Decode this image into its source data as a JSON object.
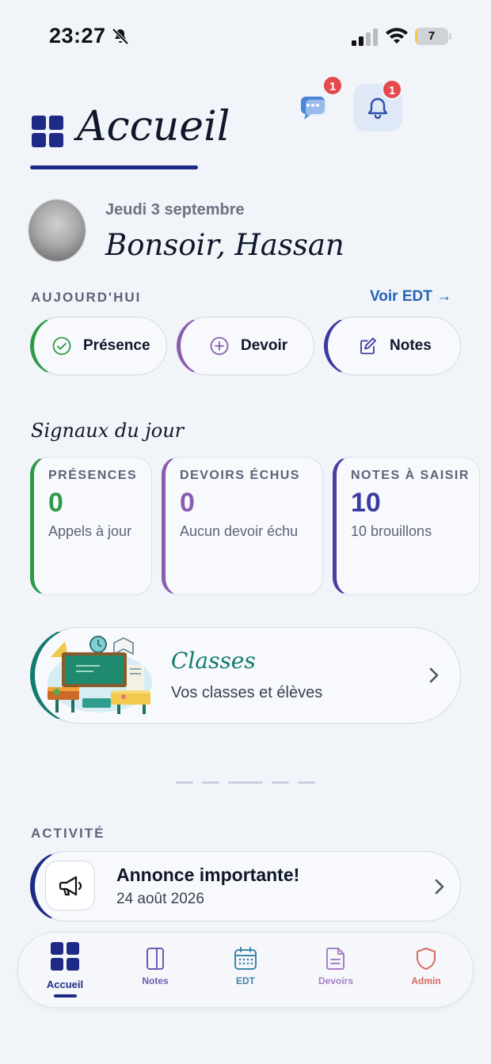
{
  "status_bar": {
    "time": "23:27",
    "battery_level": "7",
    "battery_fill": 0.07
  },
  "header": {
    "title": "Accueil",
    "chat_badge": "1",
    "notification_badge": "1"
  },
  "greeting": {
    "date": "Jeudi 3 septembre",
    "text": "Bonsoir, Hassan"
  },
  "today": {
    "label": "AUJOURD'HUI",
    "timetable_link": "Voir EDT →",
    "actions": [
      {
        "label": "Présence",
        "icon": "check-circle-icon",
        "color": "#2e9a47"
      },
      {
        "label": "Devoir",
        "icon": "plus-circle-icon",
        "color": "#8a5cb0"
      },
      {
        "label": "Notes",
        "icon": "edit-icon",
        "color": "#3b3aa0"
      }
    ]
  },
  "signals": {
    "title": "Signaux du jour",
    "cards": [
      {
        "label": "PRÉSENCES",
        "value": "0",
        "sub": "Appels à jour",
        "color": "#2e9a47"
      },
      {
        "label": "DEVOIRS ÉCHUS",
        "value": "0",
        "sub": "Aucun devoir échu",
        "color": "#8a5cb0"
      },
      {
        "label": "NOTES À SAISIR",
        "value": "10",
        "sub": "10 brouillons",
        "color": "#3b3aa0"
      }
    ]
  },
  "classes": {
    "title": "Classes",
    "subtitle": "Vos classes et élèves",
    "icon": "classroom-illustration"
  },
  "activity": {
    "label": "ACTIVITÉ",
    "item": {
      "title": "Annonce importante!",
      "date": "24 août 2026",
      "icon": "megaphone-icon"
    }
  },
  "bottom_nav": {
    "items": [
      {
        "label": "Accueil",
        "icon": "grid-icon",
        "color": "#1f2a86",
        "active": true
      },
      {
        "label": "Notes",
        "icon": "notebook-icon",
        "color": "#6d5bb0",
        "active": false
      },
      {
        "label": "EDT",
        "icon": "calendar-icon",
        "color": "#3f86a8",
        "active": false
      },
      {
        "label": "Devoirs",
        "icon": "document-icon",
        "color": "#a77fc6",
        "active": false
      },
      {
        "label": "Admin",
        "icon": "shield-icon",
        "color": "#d86b5f",
        "active": false
      }
    ]
  }
}
